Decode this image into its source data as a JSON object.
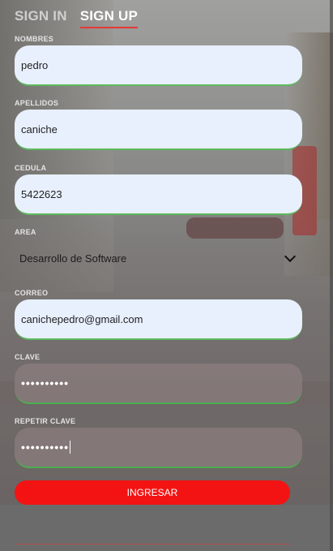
{
  "tabs": {
    "signin": "SIGN IN",
    "signup": "SIGN UP"
  },
  "form": {
    "nombres": {
      "label": "NOMBRES",
      "value": "pedro"
    },
    "apellidos": {
      "label": "APELLIDOS",
      "value": "caniche"
    },
    "cedula": {
      "label": "CEDULA",
      "value": "5422623"
    },
    "area": {
      "label": "AREA",
      "value": "Desarrollo de Software"
    },
    "correo": {
      "label": "CORREO",
      "value": "canichepedro@gmail.com"
    },
    "clave": {
      "label": "CLAVE",
      "masked": "••••••••••"
    },
    "repetir_clave": {
      "label": "REPETIR CLAVE",
      "masked": "••••••••••"
    },
    "submit_label": "INGRESAR"
  },
  "colors": {
    "accent": "#f31313",
    "valid_border": "#5cb85c",
    "field_bg": "#e8f0fe"
  },
  "icons": {
    "area_dropdown": "chevron-down-icon"
  }
}
